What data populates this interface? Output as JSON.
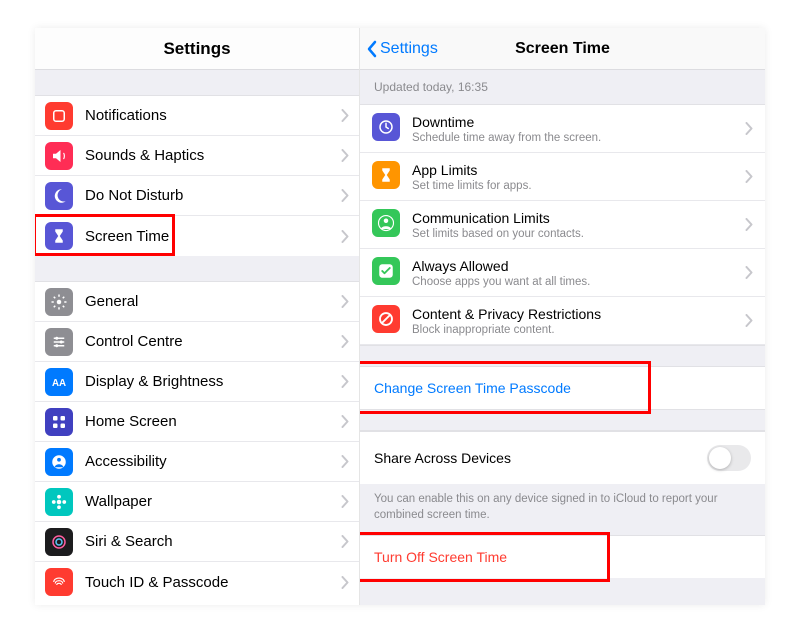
{
  "left": {
    "title": "Settings",
    "group1": [
      {
        "label": "Notifications",
        "icon": "notifications",
        "bg": "#ff3b30"
      },
      {
        "label": "Sounds & Haptics",
        "icon": "sounds",
        "bg": "#ff2d55"
      },
      {
        "label": "Do Not Disturb",
        "icon": "moon",
        "bg": "#5856d6"
      },
      {
        "label": "Screen Time",
        "icon": "hourglass",
        "bg": "#5856d6",
        "highlight": true
      }
    ],
    "group2": [
      {
        "label": "General",
        "icon": "gear",
        "bg": "#8e8e93"
      },
      {
        "label": "Control Centre",
        "icon": "sliders",
        "bg": "#8e8e93"
      },
      {
        "label": "Display & Brightness",
        "icon": "aa",
        "bg": "#007aff"
      },
      {
        "label": "Home Screen",
        "icon": "grid",
        "bg": "#4040c0"
      },
      {
        "label": "Accessibility",
        "icon": "person",
        "bg": "#007aff"
      },
      {
        "label": "Wallpaper",
        "icon": "flower",
        "bg": "#00c7be"
      },
      {
        "label": "Siri & Search",
        "icon": "siri",
        "bg": "#1c1c1e"
      },
      {
        "label": "Touch ID & Passcode",
        "icon": "fingerprint",
        "bg": "#ff3b30"
      }
    ]
  },
  "right": {
    "back": "Settings",
    "title": "Screen Time",
    "status": "Updated today, 16:35",
    "items": [
      {
        "title": "Downtime",
        "sub": "Schedule time away from the screen.",
        "icon": "clock",
        "bg": "#5856d6"
      },
      {
        "title": "App Limits",
        "sub": "Set time limits for apps.",
        "icon": "hourglass",
        "bg": "#ff9500"
      },
      {
        "title": "Communication Limits",
        "sub": "Set limits based on your contacts.",
        "icon": "contacts",
        "bg": "#34c759"
      },
      {
        "title": "Always Allowed",
        "sub": "Choose apps you want at all times.",
        "icon": "check",
        "bg": "#34c759"
      },
      {
        "title": "Content & Privacy Restrictions",
        "sub": "Block inappropriate content.",
        "icon": "nosign",
        "bg": "#ff3b30"
      }
    ],
    "change_passcode": "Change Screen Time Passcode",
    "share_label": "Share Across Devices",
    "share_footer": "You can enable this on any device signed in to iCloud to report your combined screen time.",
    "turn_off": "Turn Off Screen Time"
  }
}
